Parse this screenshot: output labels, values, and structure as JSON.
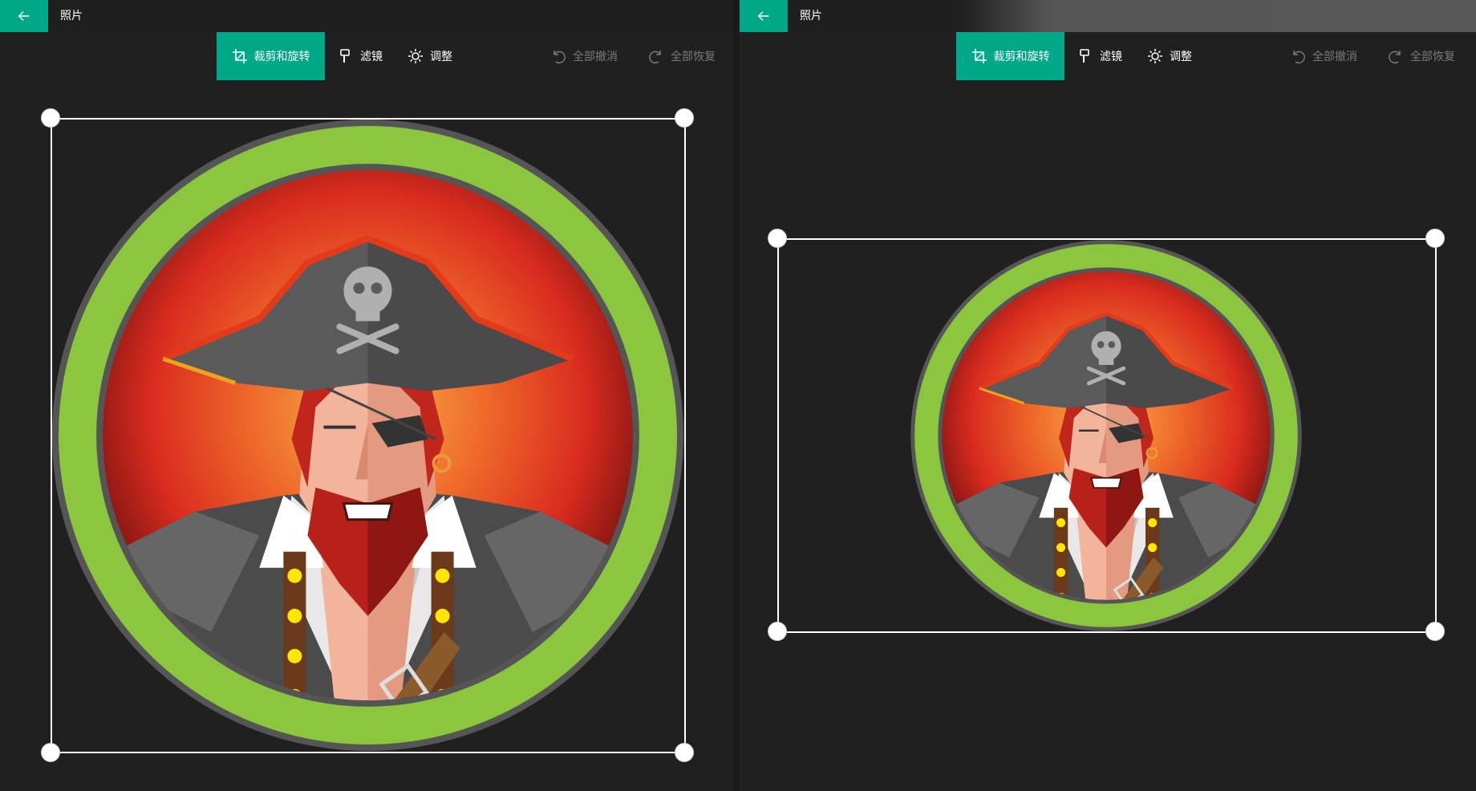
{
  "app": {
    "title": "照片"
  },
  "toolbar": {
    "crop_rotate": "裁剪和旋转",
    "filters": "滤镜",
    "adjust": "调整",
    "undo_all": "全部撤消",
    "redo_all": "全部恢复"
  },
  "colors": {
    "accent": "#00a88a",
    "background": "#202020",
    "disabled_text": "#7a7a7a",
    "ring": "#8cc63f"
  },
  "icons": {
    "back": "arrow-left-icon",
    "crop": "crop-icon",
    "filter": "brush-icon",
    "adjust": "sun-icon",
    "undo": "undo-icon",
    "redo": "redo-icon"
  }
}
